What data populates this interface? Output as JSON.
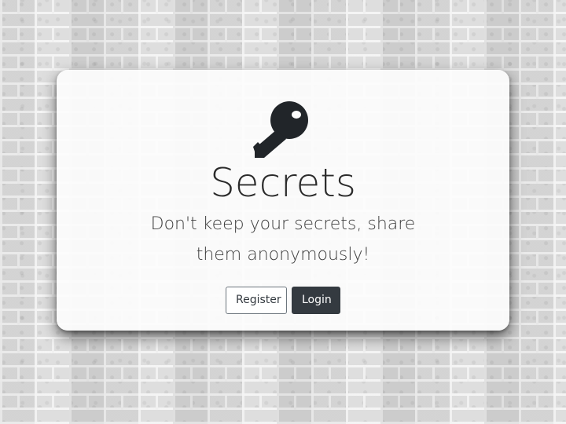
{
  "jumbotron": {
    "title": "Secrets",
    "lead": "Don't keep your secrets, share them anonymously!",
    "icon": "key-icon",
    "buttons": {
      "register_label": "Register",
      "login_label": "Login"
    }
  },
  "colors": {
    "dark": "#343a40",
    "card_background": "#fcfcfc",
    "wall": "#dcdcdc"
  }
}
